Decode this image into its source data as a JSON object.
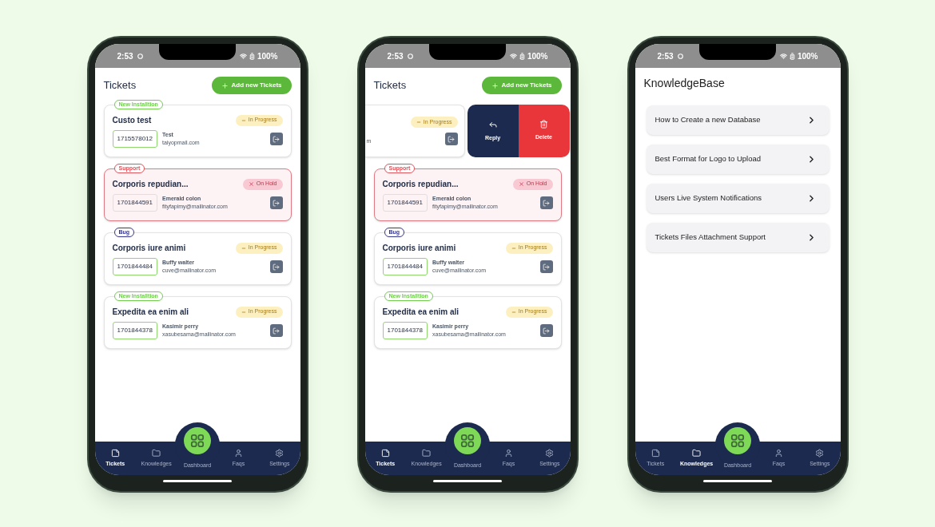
{
  "phones": [
    {
      "kind": "tickets",
      "status_bar": {
        "time": "2:53",
        "battery": "100%"
      },
      "title": "Tickets",
      "add_button": "Add new Tickets",
      "tickets": [
        {
          "kind": "card",
          "tag": "New Installtion",
          "color": "#6fcf4b",
          "title": "Custo test",
          "status": "In Progress",
          "on_hold": false,
          "number": "1715578012",
          "name": "Test",
          "email": "taiyopmail.com"
        },
        {
          "kind": "card",
          "tag": "Support",
          "color": "#e0525a",
          "title": "Corporis repudian...",
          "status": "On Hold",
          "on_hold": true,
          "number": "1701844591",
          "name": "Emerald colon",
          "email": "fityfapimy@mailinator.com"
        },
        {
          "kind": "card",
          "tag": "Bug",
          "color": "#34358f",
          "title": "Corporis iure animi",
          "status": "In Progress",
          "on_hold": false,
          "number": "1701844484",
          "name": "Buffy walter",
          "email": "cuve@mailinator.com"
        },
        {
          "kind": "card",
          "tag": "New Installtion",
          "color": "#6fcf4b",
          "title": "Expedita ea enim ali",
          "status": "In Progress",
          "on_hold": false,
          "number": "1701844378",
          "name": "Kasimir perry",
          "email": "xasubesama@mailinator.com"
        }
      ],
      "nav": [
        {
          "kind": "tickets",
          "label": "Tickets",
          "selected": true
        },
        {
          "kind": "folder",
          "label": "Knowledges",
          "selected": false
        },
        {
          "kind": "dashboard",
          "label": "Dashboard",
          "selected": false
        },
        {
          "kind": "person",
          "label": "Faqs",
          "selected": false
        },
        {
          "kind": "settings",
          "label": "Settings",
          "selected": false
        }
      ]
    },
    {
      "kind": "tickets",
      "status_bar": {
        "time": "2:53",
        "battery": "100%"
      },
      "title": "Tickets",
      "add_button": "Add new Tickets",
      "tickets": [
        {
          "kind": "swiped",
          "status": "In Progress",
          "on_hold": false,
          "email": "m",
          "actions": [
            {
              "kind": "reply",
              "label": "Reply"
            },
            {
              "kind": "delete",
              "label": "Delete"
            }
          ]
        },
        {
          "kind": "card",
          "tag": "Support",
          "color": "#e0525a",
          "title": "Corporis repudian...",
          "status": "On Hold",
          "on_hold": true,
          "number": "1701844591",
          "name": "Emerald colon",
          "email": "fityfapimy@mailinator.com"
        },
        {
          "kind": "card",
          "tag": "Bug",
          "color": "#34358f",
          "title": "Corporis iure animi",
          "status": "In Progress",
          "on_hold": false,
          "number": "1701844484",
          "name": "Buffy walter",
          "email": "cuve@mailinator.com"
        },
        {
          "kind": "card",
          "tag": "New Installtion",
          "color": "#6fcf4b",
          "title": "Expedita ea enim ali",
          "status": "In Progress",
          "on_hold": false,
          "number": "1701844378",
          "name": "Kasimir perry",
          "email": "xasubesama@mailinator.com"
        }
      ],
      "nav": [
        {
          "kind": "tickets",
          "label": "Tickets",
          "selected": true
        },
        {
          "kind": "folder",
          "label": "Knowledges",
          "selected": false
        },
        {
          "kind": "dashboard",
          "label": "Dashboard",
          "selected": false
        },
        {
          "kind": "person",
          "label": "Faqs",
          "selected": false
        },
        {
          "kind": "settings",
          "label": "Settings",
          "selected": false
        }
      ]
    },
    {
      "kind": "knowledge",
      "status_bar": {
        "time": "2:53",
        "battery": "100%"
      },
      "title": "KnowledgeBase",
      "articles": [
        "How to Create a new Database",
        "Best Format for Logo to Upload",
        "Users Live System Notifications",
        "Tickets Files Attachment Support"
      ],
      "nav": [
        {
          "kind": "tickets",
          "label": "Tickets",
          "selected": false
        },
        {
          "kind": "folder",
          "label": "Knowledges",
          "selected": true
        },
        {
          "kind": "dashboard",
          "label": "Dashboard",
          "selected": false
        },
        {
          "kind": "person",
          "label": "Faqs",
          "selected": false
        },
        {
          "kind": "settings",
          "label": "Settings",
          "selected": false
        }
      ]
    }
  ]
}
